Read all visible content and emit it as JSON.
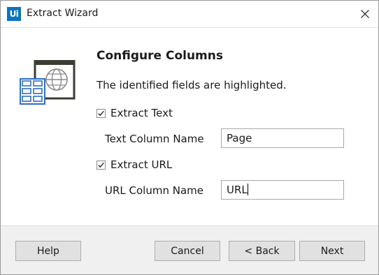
{
  "window": {
    "title": "Extract Wizard",
    "logo_text": "Ui"
  },
  "main": {
    "heading": "Configure Columns",
    "description": "The identified fields are highlighted.",
    "extract_text": {
      "label": "Extract Text",
      "checked": true
    },
    "text_column": {
      "label": "Text Column Name",
      "value": "Page"
    },
    "extract_url": {
      "label": "Extract URL",
      "checked": true
    },
    "url_column": {
      "label": "URL Column Name",
      "value": "URL"
    }
  },
  "footer": {
    "help_label": "Help",
    "cancel_label": "Cancel",
    "back_label": "< Back",
    "next_label": "Next"
  },
  "colors": {
    "logo_blue": "#0a74c0",
    "table_blue": "#2d6fc0",
    "frame_dark": "#3c3c32",
    "footer_bg": "#f0f0f0"
  }
}
